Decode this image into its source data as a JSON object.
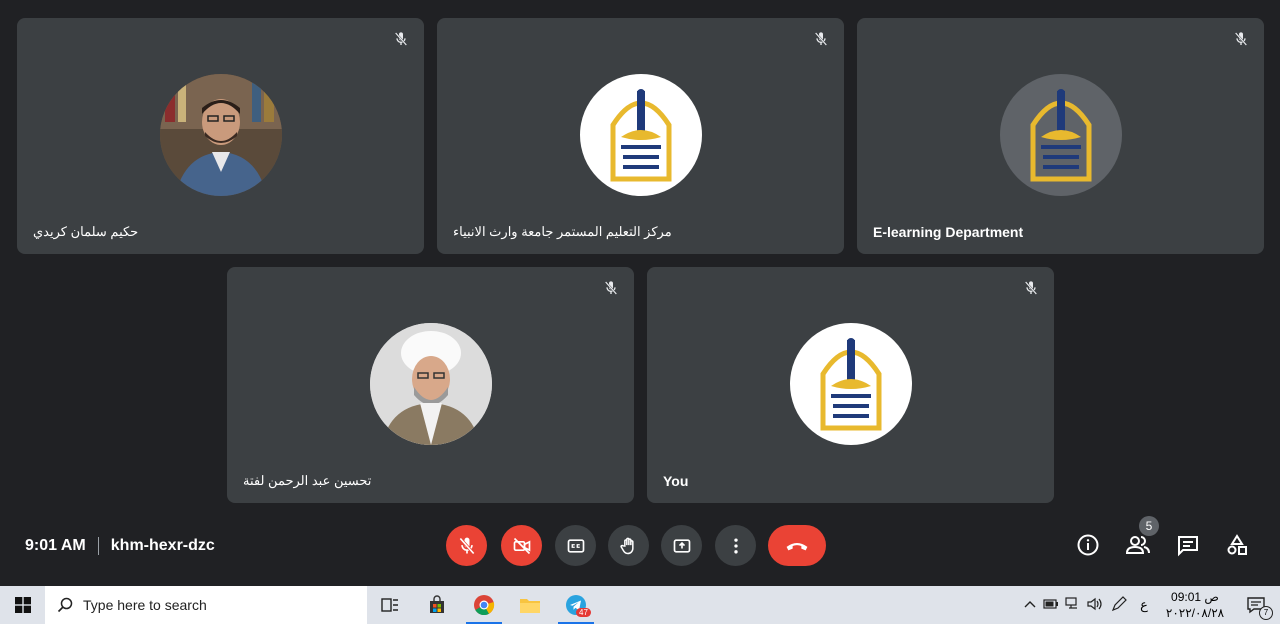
{
  "participants": [
    {
      "name": "حكيم سلمان كريدي",
      "avatar": "person-photo",
      "muted": true
    },
    {
      "name": "مركز التعليم المستمر جامعة وارث الانبياء",
      "avatar": "university-logo",
      "muted": true
    },
    {
      "name": "E-learning Department",
      "avatar": "university-logo-dark",
      "muted": true
    },
    {
      "name": "تحسين عبد الرحمن لفتة",
      "avatar": "cleric-photo",
      "muted": true
    },
    {
      "name": "You",
      "avatar": "university-logo",
      "muted": true
    }
  ],
  "meeting": {
    "time": "9:01 AM",
    "code": "khm-hexr-dzc"
  },
  "controls": [
    "mic-off",
    "camera-off",
    "captions",
    "raise-hand",
    "present",
    "more-options",
    "leave-call"
  ],
  "right_controls": {
    "people_count": "5",
    "icons": [
      "info-icon",
      "people-icon",
      "chat-icon",
      "activities-icon"
    ]
  },
  "taskbar": {
    "search_placeholder": "Type here to search",
    "telegram_badge": "47",
    "tray_lang": "ع",
    "clock_time": "09:01 ص",
    "clock_date": "٢٠٢٢/٠٨/٢٨",
    "notification_count": "7"
  },
  "colors": {
    "background": "#202124",
    "tile": "#3c4043",
    "danger": "#ea4335",
    "logo_gold": "#e8b92e",
    "logo_navy": "#1f3a7a"
  }
}
